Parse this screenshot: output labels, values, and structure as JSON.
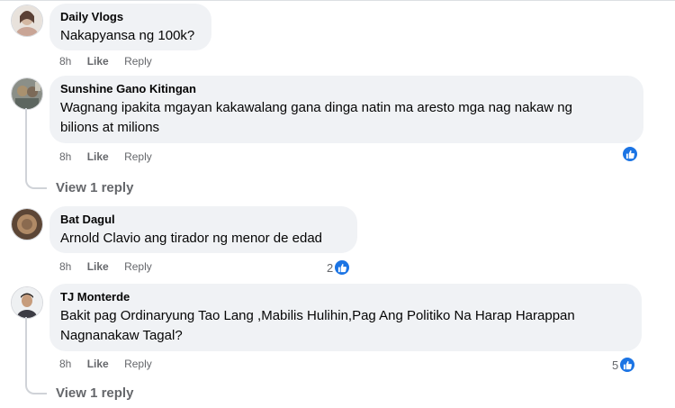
{
  "comments": [
    {
      "author": "Daily Vlogs",
      "text": [
        "Nakapyansa ng 100k?"
      ],
      "time": "8h",
      "like": "Like",
      "reply": "Reply"
    },
    {
      "author": "Sunshine Gano Kitingan",
      "text": [
        "Wagnang ipakita mgayan kakawalang gana dinga natin ma aresto mga nag nakaw ng",
        "bilions at milions"
      ],
      "time": "8h",
      "like": "Like",
      "reply": "Reply",
      "view_replies": "View 1 reply"
    },
    {
      "author": "Bat Dagul",
      "text": [
        "Arnold Clavio ang tirador ng menor de edad"
      ],
      "time": "8h",
      "like": "Like",
      "reply": "Reply",
      "reaction_count": "2"
    },
    {
      "author": "TJ Monterde",
      "text": [
        "Bakit pag Ordinaryung Tao Lang ,Mabilis Hulihin,Pag Ang Politiko Na Harap Harappan",
        "Nagnanakaw Tagal?"
      ],
      "time": "8h",
      "like": "Like",
      "reply": "Reply",
      "reaction_count": "5",
      "view_replies": "View 1 reply"
    }
  ],
  "colors": {
    "bubble": "#f0f2f5",
    "meta": "#65676b",
    "like_blue": "#1b74e4"
  },
  "icons": {
    "reaction": "like-thumb-icon"
  }
}
